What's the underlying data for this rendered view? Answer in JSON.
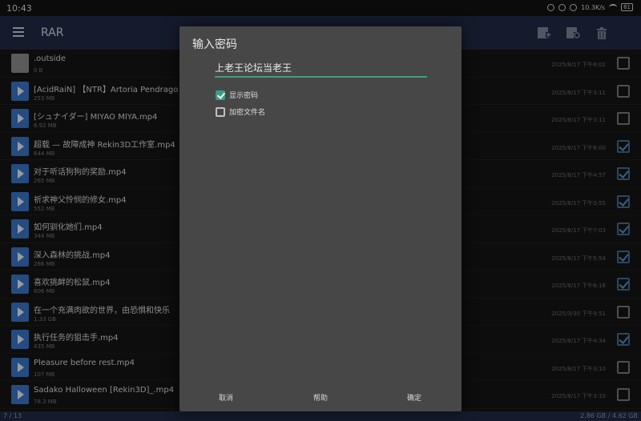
{
  "statusbar": {
    "time": "10:43",
    "speed": "10.3K/s",
    "battery": "61"
  },
  "toolbar": {
    "title": "RAR",
    "menu_icon": "hamburger-menu-icon",
    "tools": [
      "add-to-archive-icon",
      "extract-icon",
      "delete-icon"
    ]
  },
  "files": [
    {
      "name": ".outside",
      "size": "0 B",
      "date": "2025/8/17 下午8:02",
      "checked": false,
      "type": "file"
    },
    {
      "name": "[AcidRaiN] 【NTR】Artoria Pendrago",
      "size": "253 MB",
      "date": "2025/8/17 下午3:11",
      "checked": false,
      "type": "video"
    },
    {
      "name": "[シュナイダー] MIYAO MIYA.mp4",
      "size": "6.92 MB",
      "date": "2025/8/17 下午3:11",
      "checked": false,
      "type": "video"
    },
    {
      "name": "超载 — 故障成神 Rekin3D工作室.mp4",
      "size": "644 MB",
      "date": "2025/8/17 下午8:00",
      "checked": true,
      "type": "video"
    },
    {
      "name": "对于听话狗狗的奖励.mp4",
      "size": "265 MB",
      "date": "2025/8/17 下午4:57",
      "checked": true,
      "type": "video"
    },
    {
      "name": "祈求神父怜悯的修女.mp4",
      "size": "552 MB",
      "date": "2025/8/17 下午3:55",
      "checked": true,
      "type": "video"
    },
    {
      "name": "如何驯化她们.mp4",
      "size": "344 MB",
      "date": "2025/8/17 下午7:03",
      "checked": true,
      "type": "video"
    },
    {
      "name": "深入森林的挑战.mp4",
      "size": "286 MB",
      "date": "2025/8/17 下午5:54",
      "checked": true,
      "type": "video"
    },
    {
      "name": "喜欢挑衅的松鼠.mp4",
      "size": "606 MB",
      "date": "2025/8/17 下午6:18",
      "checked": true,
      "type": "video"
    },
    {
      "name": "在一个充满肉欲的世界，由恐惧和快乐",
      "size": "1.33 GB",
      "date": "2025/3/30 下午9:51",
      "checked": false,
      "type": "video"
    },
    {
      "name": "执行任务的狙击手.mp4",
      "size": "435 MB",
      "date": "2025/8/17 下午4:34",
      "checked": true,
      "type": "video"
    },
    {
      "name": "Pleasure before rest.mp4",
      "size": "107 MB",
      "date": "2025/8/17 下午3:10",
      "checked": false,
      "type": "video"
    },
    {
      "name": "Sadako Halloween [Rekin3D]_.mp4",
      "size": "78.3 MB",
      "date": "2025/8/17 下午3:10",
      "checked": false,
      "type": "video"
    }
  ],
  "bottombar": {
    "count": "7 / 13",
    "space": "2.86 GB / 4.62 GB"
  },
  "dialog": {
    "title": "输入密码",
    "password_value": "上老王论坛当老王",
    "show_password_label": "显示密码",
    "show_password_checked": true,
    "encrypt_names_label": "加密文件名",
    "encrypt_names_checked": false,
    "cancel_label": "取消",
    "help_label": "帮助",
    "ok_label": "确定"
  },
  "colors": {
    "toolbar": "#1f2a44",
    "accent": "#3f9a8a",
    "dialog_bg": "#474747"
  }
}
